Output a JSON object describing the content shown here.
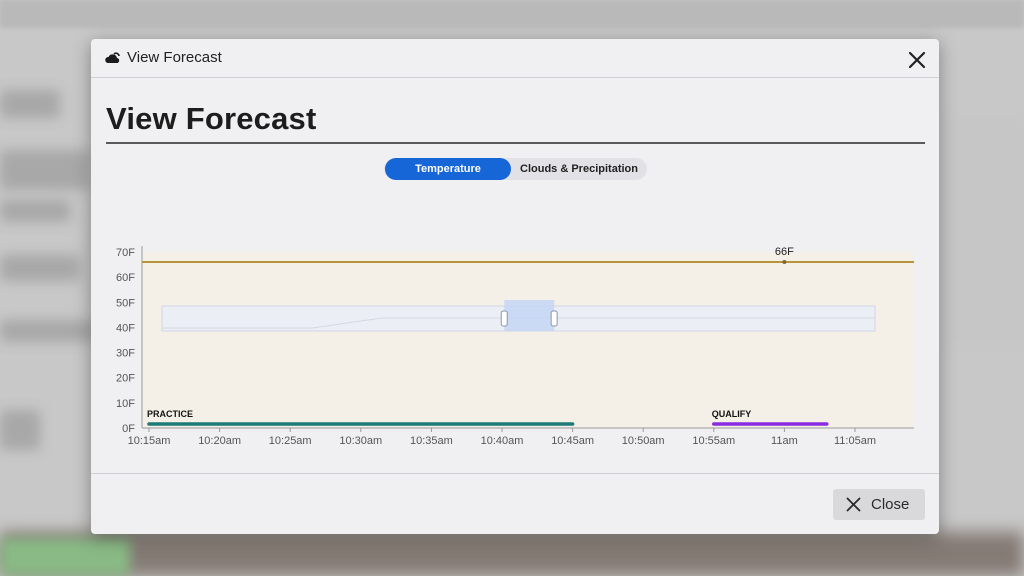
{
  "dialog": {
    "window_title": "View Forecast",
    "heading": "View Forecast",
    "close_label": "Close"
  },
  "tabs": [
    {
      "label": "Temperature",
      "active": true
    },
    {
      "label": "Clouds & Precipitation",
      "active": false
    }
  ],
  "icons": {
    "title_icon": "weather-cloud-icon",
    "close_x": "close-icon",
    "close_button_icon": "x-icon"
  },
  "colors": {
    "accent": "#1666d8",
    "temperature_line": "#b8943a",
    "plot_fill": "#f4f0e8",
    "practice": "#1d7a76",
    "qualify": "#8a2be2"
  },
  "chart_data": {
    "type": "line",
    "y_ticks": [
      "0F",
      "10F",
      "20F",
      "30F",
      "40F",
      "50F",
      "60F",
      "70F"
    ],
    "ylim": [
      0,
      70
    ],
    "x_ticks": [
      "10:15am",
      "10:20am",
      "10:25am",
      "10:30am",
      "10:35am",
      "10:40am",
      "10:45am",
      "10:50am",
      "10:55am",
      "11am",
      "11:05am"
    ],
    "series": [
      {
        "values": [
          66,
          66,
          66,
          66,
          66,
          66,
          66,
          66,
          66,
          66,
          66,
          66
        ]
      }
    ],
    "highlight_point": {
      "x": "11am",
      "y": 66,
      "label": "66F"
    },
    "sessions": [
      {
        "name": "PRACTICE",
        "start": "10:15am",
        "end": "10:45am"
      },
      {
        "name": "QUALIFY",
        "start": "10:55am",
        "end": "11:03am"
      }
    ],
    "range_selector": {
      "selected_start_fraction": 0.48,
      "selected_end_fraction": 0.55
    }
  }
}
